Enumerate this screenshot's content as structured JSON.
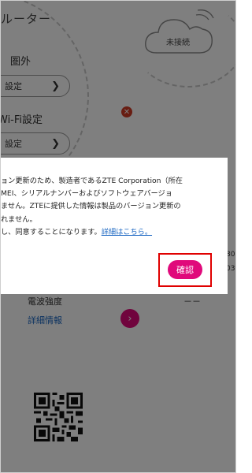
{
  "app": {
    "title": "ルーター",
    "signal": "圏外",
    "settings_button": "設定",
    "wifi_label": "Wi-Fi設定",
    "wifi_settings_button": "設定",
    "connection_status": "未接続",
    "signal_strength_label": "電波強度",
    "signal_strength_value": "－－",
    "detail_link": "詳細情報",
    "right_fragments": [
      "80",
      "03"
    ]
  },
  "dialog": {
    "line1": "ョン更新のため、製造者であるZTE Corporation（所在",
    "line2": "MEI、シリアルナンバーおよびソフトウェアバージョ",
    "line3": "ません。ZTEに提供した情報は製品のバージョン更新の",
    "line4": "れません。",
    "line5_prefix": "し、同意することになります。",
    "line5_link": "詳細はこちら。",
    "confirm_button": "確認"
  },
  "colors": {
    "accent": "#e0097b",
    "link": "#1a66c2",
    "highlight_border": "#e00000",
    "error_icon": "#d13a24"
  }
}
